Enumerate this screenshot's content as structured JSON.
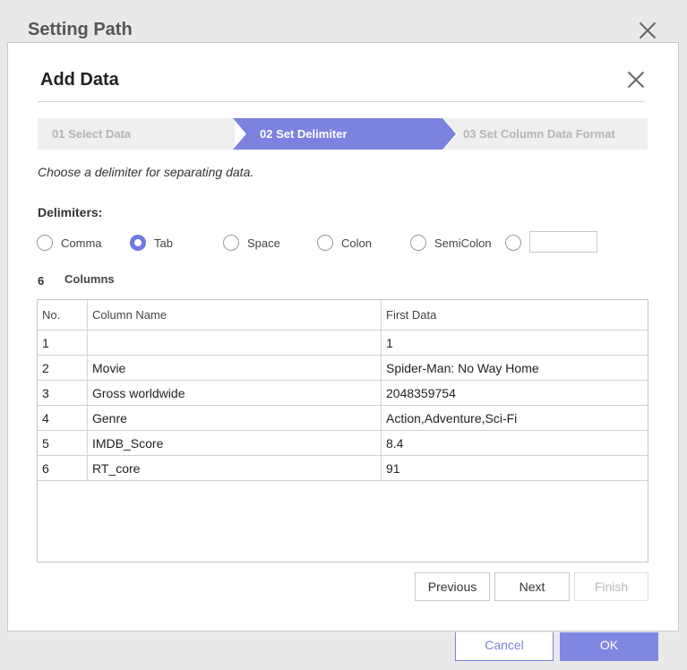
{
  "outer": {
    "title": "Setting Path",
    "cancel_label": "Cancel",
    "ok_label": "OK"
  },
  "dialog": {
    "title": "Add Data",
    "steps": [
      {
        "label": "01 Select Data"
      },
      {
        "label": "02 Set Delimiter"
      },
      {
        "label": "03 Set Column Data Format"
      }
    ],
    "active_step": 2,
    "instruction": "Choose a delimiter for separating data.",
    "delimiters_label": "Delimiters:",
    "delimiter_options": [
      {
        "label": "Comma",
        "checked": false
      },
      {
        "label": "Tab",
        "checked": true
      },
      {
        "label": "Space",
        "checked": false
      },
      {
        "label": "Colon",
        "checked": false
      },
      {
        "label": "SemiColon",
        "checked": false
      },
      {
        "label": "",
        "checked": false
      }
    ],
    "custom_delimiter_value": "",
    "column_count": "6",
    "columns_label": "Columns",
    "table": {
      "headers": [
        "No.",
        "Column Name",
        "First Data"
      ],
      "rows": [
        [
          "1",
          "",
          "1"
        ],
        [
          "2",
          "Movie",
          "Spider-Man: No Way Home"
        ],
        [
          "3",
          "Gross worldwide",
          "2048359754"
        ],
        [
          "4",
          "Genre",
          "Action,Adventure,Sci-Fi"
        ],
        [
          "5",
          "IMDB_Score",
          "8.4"
        ],
        [
          "6",
          "RT_core",
          "91"
        ]
      ]
    },
    "buttons": {
      "previous": "Previous",
      "next": "Next",
      "finish": "Finish"
    }
  },
  "colors": {
    "accent": "#7b82df",
    "radio_checked": "#6f79e3",
    "step_inactive_bg": "#efeff2"
  }
}
